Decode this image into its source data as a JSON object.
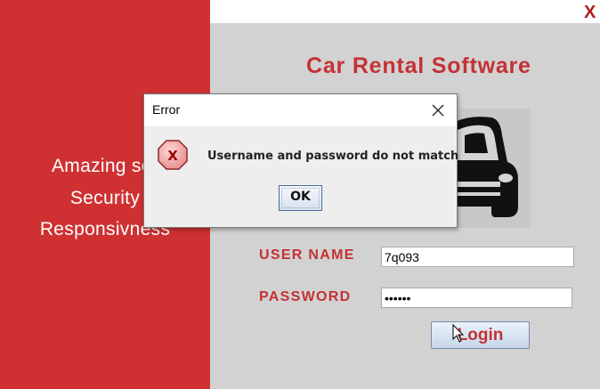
{
  "window": {
    "close_glyph": "X",
    "close_color": "#b01e1e"
  },
  "colors": {
    "brand_red": "#cf3133",
    "title_red": "#c43234",
    "panel_gray": "#d2d2d2"
  },
  "left_panel": {
    "taglines": [
      "Amazing ser",
      "Security",
      "Responsivness"
    ]
  },
  "app": {
    "title": "Car Rental Software",
    "car_icon": "car-front-icon"
  },
  "form": {
    "username_label": "USER NAME",
    "username_value": "7q093",
    "password_label": "PASSWORD",
    "password_value": "••••••",
    "login_label": "Login"
  },
  "dialog": {
    "title": "Error",
    "message": "Username and password do not match",
    "ok_label": "OK",
    "icon": "error-icon",
    "icon_glyph": "X"
  }
}
